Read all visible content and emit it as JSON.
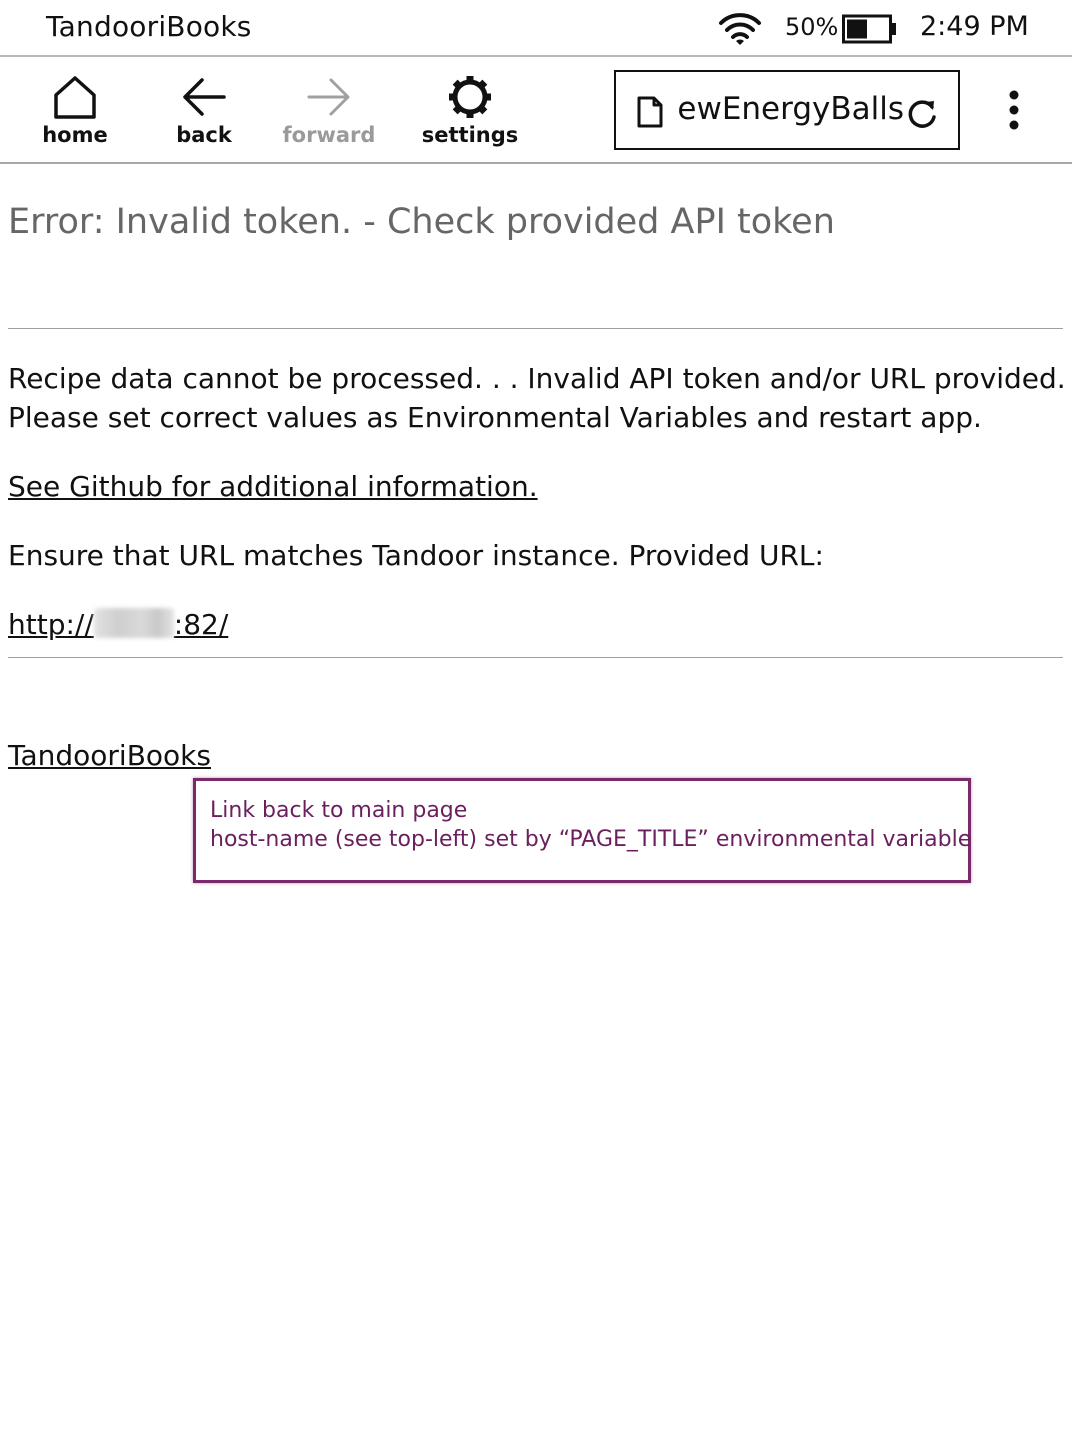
{
  "status_bar": {
    "title": "TandooriBooks",
    "battery_percent": "50%",
    "battery_level": 0.5,
    "time": "2:49 PM",
    "icons": [
      "wifi-icon",
      "battery-icon"
    ]
  },
  "toolbar": {
    "home_label": "home",
    "back_label": "back",
    "forward_label": "forward",
    "settings_label": "settings",
    "url_text": "ewEnergyBalls",
    "icons": [
      "home-icon",
      "back-arrow-icon",
      "forward-arrow-icon",
      "gear-icon",
      "document-icon",
      "reload-icon",
      "more-vertical-icon"
    ]
  },
  "content": {
    "error_heading": "Error: Invalid token. - Check provided API token",
    "message_line_1": "Recipe data cannot be processed. . . Invalid API token and/or URL provided.",
    "message_line_2": "Please set correct values as Environmental Variables and restart app.",
    "github_link": "See Github for additional information.",
    "ensure_text": "Ensure that URL matches Tandoor instance. Provided URL:",
    "provided_url_prefix": "http://",
    "provided_url_suffix": ":82/",
    "footer_link": "TandooriBooks"
  },
  "annotation": {
    "line_1": "Link back to main page",
    "line_2": "host-name (see top-left) set by “PAGE_TITLE” environmental variable",
    "border_color": "#7a2a6a",
    "text_color": "#6b1f5e"
  }
}
